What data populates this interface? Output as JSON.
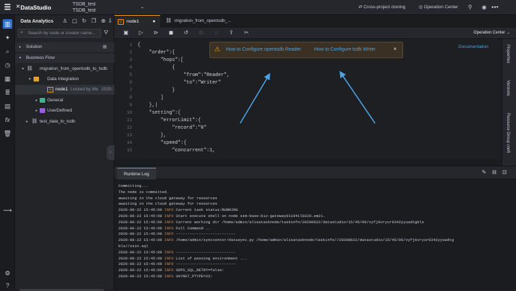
{
  "app": {
    "brand": "DataStudio",
    "workspace_line1": "TSDB_test",
    "workspace_line2": "TSDB_test",
    "cross_project": "Cross-project cloning",
    "operation_center": "Operation Center",
    "top_icons": [
      "tree-icon",
      "lock-icon",
      "wifi-icon",
      "caret-icon"
    ]
  },
  "rail": {
    "icons": [
      "data-studio-icon",
      "home-icon",
      "search-icon",
      "clock-icon",
      "calendar-icon",
      "list-icon",
      "table-icon",
      "function-icon",
      "trash-icon",
      "flow-icon",
      "settings-icon",
      "help-icon"
    ]
  },
  "explorer": {
    "title": "Data Analytics",
    "search_placeholder": "Search by node or creator name...",
    "solution": "Solution",
    "business_flow": "Business Flow",
    "tree": [
      {
        "label": "migration_from_opentsdb_to_tsdb"
      },
      {
        "label": "Data Integration"
      },
      {
        "label": "node1",
        "meta": "Locked by Me",
        "meta2": "2020-"
      },
      {
        "label": "General"
      },
      {
        "label": "UserDefined"
      },
      {
        "label": "test_data_to_tsdb"
      }
    ]
  },
  "tabs": [
    {
      "label": "node1",
      "icon_text": "DI"
    },
    {
      "label": "migration_from_opentsdb_..."
    }
  ],
  "toolbar": {
    "operation_center": "Operation Center"
  },
  "editor": {
    "lines": [
      {
        "n": "1",
        "text": "{"
      },
      {
        "n": "2",
        "text": "    \"order\":{"
      },
      {
        "n": "3",
        "text": "        \"hops\":["
      },
      {
        "n": "4",
        "text": "            {"
      },
      {
        "n": "5",
        "text": "                \"from\":\"Reader\","
      },
      {
        "n": "6",
        "text": "                \"to\":\"Writer\""
      },
      {
        "n": "7",
        "text": "            }"
      },
      {
        "n": "8",
        "text": "        ]"
      },
      {
        "n": "9",
        "text": "    },|"
      },
      {
        "n": "10",
        "text": "    \"setting\":{"
      },
      {
        "n": "11",
        "text": "        \"errorLimit\":{"
      },
      {
        "n": "12",
        "text": "            \"record\":\"0\""
      },
      {
        "n": "13",
        "text": "        },"
      },
      {
        "n": "14",
        "text": "        \"speed\":{"
      },
      {
        "n": "15",
        "text": "            \"concurrent\":1,"
      }
    ],
    "documentation": "Documentation"
  },
  "notice": {
    "link1": "How to Configure opentsdb Reader",
    "link2": "How to Configure tsdb Writer",
    "close": "×"
  },
  "right_panel": {
    "tabs": [
      "Properties",
      "Versions",
      "Resource Group confi"
    ]
  },
  "log": {
    "tab": "Runtime Log",
    "lines": [
      {
        "ts": "",
        "lvl": "",
        "msg": "Committing..."
      },
      {
        "ts": "",
        "lvl": "",
        "msg": "The node is committed."
      },
      {
        "ts": "",
        "lvl": "",
        "msg": "awaiting in the cloud gateway for resources"
      },
      {
        "ts": "",
        "lvl": "",
        "msg": "awaiting in the cloud gateway for resources"
      },
      {
        "ts": "2020-06-22 15:45:09",
        "lvl": "INFO",
        "msg": "Current task status:RUNNING"
      },
      {
        "ts": "2020-06-22 15:45:09",
        "lvl": "INFO",
        "msg": "Start execute shell on node ssm-base-biz-gateway011941l0229.em21."
      },
      {
        "ts": "2020-06-22 15:45:09",
        "lvl": "INFO",
        "msg": "Current working dir /home/admin/alisatasknode/taskinfo/20200622/datastudio/15/45/06/vyfj6vryur9342yyuadtgbls"
      },
      {
        "ts": "2020-06-22 15:45:09",
        "lvl": "INFO",
        "msg": "Full Command .."
      },
      {
        "ts": "2020-06-22 15:45:09",
        "lvl": "INFO",
        "msg": "--------------------------"
      },
      {
        "ts": "2020-06-22 15:45:09",
        "lvl": "INFO",
        "msg": "/home/admin/synccenter/datasync.py /home/admin/alisatasknode/taskinfo//20200622/datastudio/15/45/06/vyfj6vryur9342yyuadtg"
      },
      {
        "ts": "",
        "lvl": "",
        "msg": "bls//ssin.sql"
      },
      {
        "ts": "2020-06-22 15:45:09",
        "lvl": "INFO",
        "msg": "--------------------------"
      },
      {
        "ts": "2020-06-22 15:45:09",
        "lvl": "INFO",
        "msg": "List of passing environment ..."
      },
      {
        "ts": "2020-06-22 15:45:09",
        "lvl": "INFO",
        "msg": "--------------------------"
      },
      {
        "ts": "2020-06-22 15:45:09",
        "lvl": "INFO",
        "msg": "SDPS_SQL_RETRY=false:"
      },
      {
        "ts": "2020-06-22 15:45:09",
        "lvl": "INFO",
        "msg": "SKYNET_PTYPE=23:"
      }
    ]
  },
  "colors": {
    "accent_orange": "#f0a020",
    "link_blue": "#4ba3e3",
    "bg": "#1d1f23"
  }
}
